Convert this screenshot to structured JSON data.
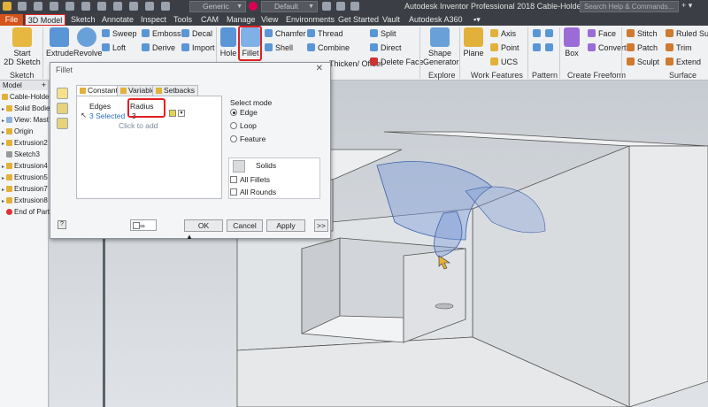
{
  "title": {
    "style_combo": "Generic",
    "appearance_combo": "Default",
    "app_title": "Autodesk Inventor Professional 2018    Cable-Holder",
    "search_placeholder": "Search Help & Commands..."
  },
  "tabs": [
    "File",
    "3D Model",
    "Sketch",
    "Annotate",
    "Inspect",
    "Tools",
    "CAM",
    "Manage",
    "View",
    "Environments",
    "Get Started",
    "Vault",
    "Autodesk A360"
  ],
  "ribbon": {
    "start_sketch": [
      "Start",
      "2D Sketch"
    ],
    "sketch_label": "Sketch",
    "extrude": "Extrude",
    "revolve": "Revolve",
    "sweep": "Sweep",
    "loft": "Loft",
    "emboss": "Emboss",
    "derive": "Derive",
    "decal": "Decal",
    "import": "Import",
    "hole": "Hole",
    "fillet": "Fillet",
    "chamfer": "Chamfer",
    "shell": "Shell",
    "thread": "Thread",
    "combine": "Combine",
    "thicken": "Thicken/ Offset",
    "split": "Split",
    "direct": "Direct",
    "delete_face": "Delete Face",
    "shape_generator": [
      "Shape",
      "Generator"
    ],
    "explore_label": "Explore",
    "plane": "Plane",
    "axis": "Axis",
    "point": "Point",
    "ucs": "UCS",
    "work_features_label": "Work Features",
    "pattern_label": "Pattern",
    "box": "Box",
    "face": "Face",
    "convert": "Convert",
    "freeform_label": "Create Freeform",
    "stitch": "Stitch",
    "patch": "Patch",
    "sculpt": "Sculpt",
    "ruled_surface": "Ruled Surfa",
    "trim": "Trim",
    "extend": "Extend",
    "surface_label": "Surface"
  },
  "browser": {
    "tab": "Model",
    "items": [
      "Cable-Holder",
      "Solid Bodie",
      "View: Mast",
      "Origin",
      "Extrusion2",
      "Sketch3",
      "Extrusion4",
      "Extrusion5",
      "Extrusion7",
      "Extrusion8",
      "End of Part"
    ]
  },
  "dialog": {
    "title": "Fillet",
    "tabs": [
      "Constant",
      "Variable",
      "Setbacks"
    ],
    "edges_header": "Edges",
    "edges_value": "3 Selected",
    "radius_header": "Radius",
    "radius_value": "3",
    "click_to_add": "Click to add",
    "select_mode": "Select mode",
    "modes": [
      "Edge",
      "Loop",
      "Feature"
    ],
    "solids": "Solids",
    "all_fillets": "All Fillets",
    "all_rounds": "All Rounds",
    "ok": "OK",
    "cancel": "Cancel",
    "apply": "Apply",
    "more": ">>"
  },
  "colors": {
    "accent_red": "#e02020",
    "file_tab": "#d4531a",
    "preview_blue": "#7f9ed9"
  }
}
